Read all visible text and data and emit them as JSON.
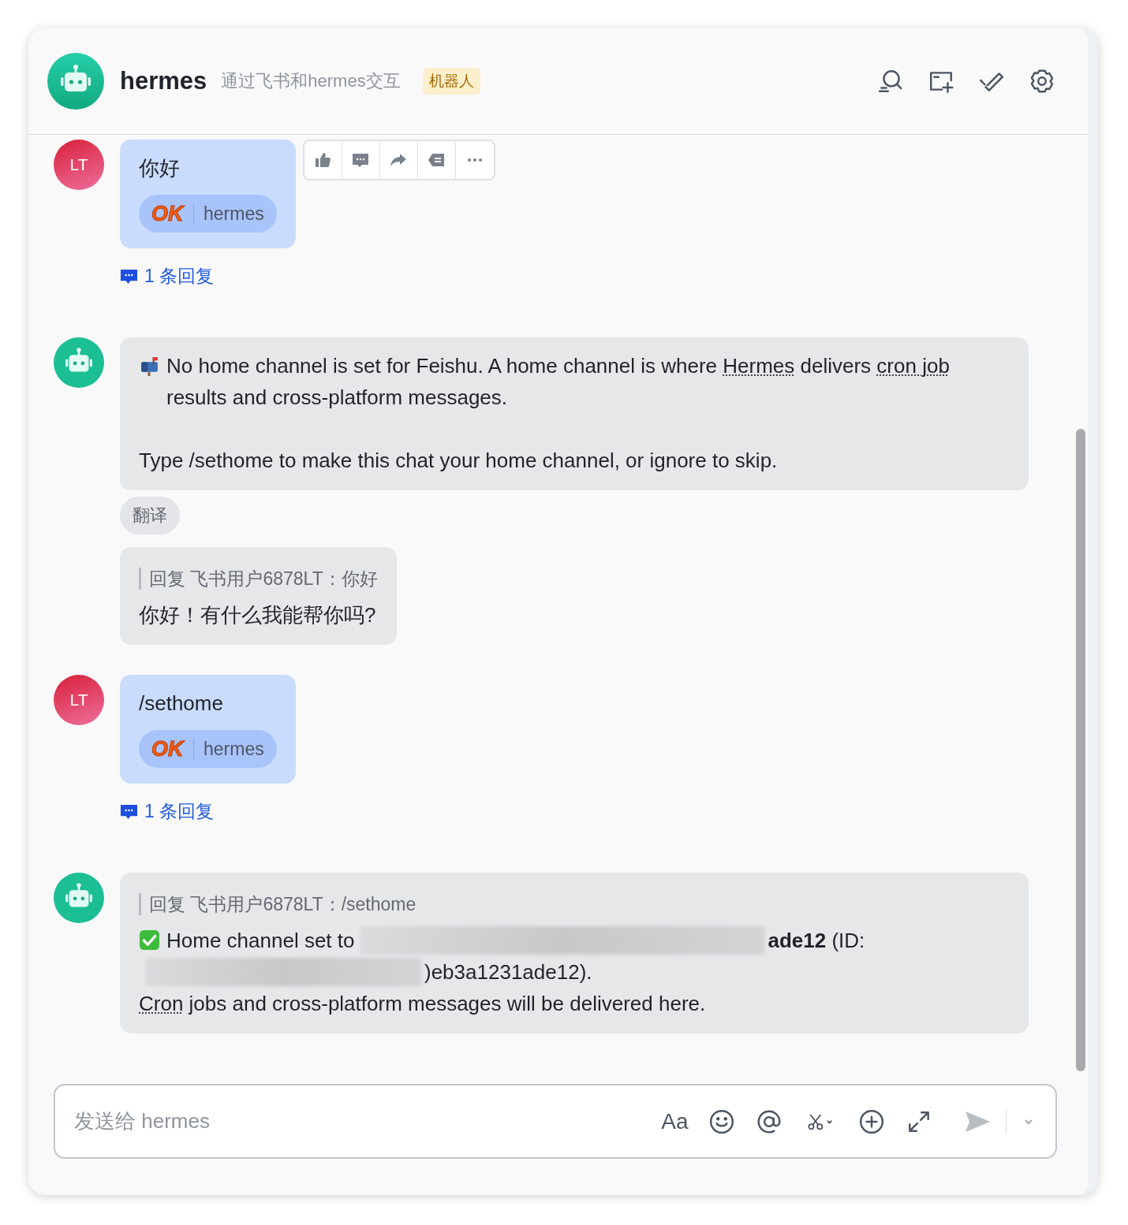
{
  "header": {
    "name": "hermes",
    "description": "通过飞书和hermes交互",
    "badge": "机器人"
  },
  "messages": [
    {
      "kind": "user",
      "show_avatar": true,
      "avatar": "LT",
      "hover_toolbar": true,
      "paragraphs": [
        {
          "runs": [
            {
              "kind": "text",
              "parts": [
                {
                  "text": "你好",
                  "dotted": false
                }
              ]
            }
          ]
        }
      ],
      "reaction": {
        "emoji": "OK",
        "user": "hermes"
      },
      "replies": "1 条回复"
    },
    {
      "kind": "bot",
      "show_avatar": true,
      "hover_toolbar": false,
      "paragraphs": [
        {
          "runs": [
            {
              "kind": "mailbox"
            },
            {
              "kind": "text",
              "parts": [
                {
                  "text": "No home channel is set for Feishu. A home channel is where ",
                  "dotted": false
                },
                {
                  "text": "Hermes",
                  "dotted": true
                },
                {
                  "text": " delivers ",
                  "dotted": false
                },
                {
                  "text": "cron job",
                  "dotted": true
                },
                {
                  "text": " results and cross-platform messages.",
                  "dotted": false
                }
              ]
            }
          ]
        },
        {
          "runs": [
            {
              "kind": "text",
              "parts": [
                {
                  "text": "Type /sethome to make this chat your home channel, or ignore to skip.",
                  "dotted": false
                }
              ]
            }
          ]
        }
      ],
      "translate": "翻译"
    },
    {
      "kind": "bot",
      "show_avatar": false,
      "hover_toolbar": false,
      "quote": "回复 飞书用户6878LT：你好",
      "paragraphs": [
        {
          "runs": [
            {
              "kind": "text",
              "parts": [
                {
                  "text": "你好！有什么我能帮你吗?",
                  "dotted": false
                }
              ]
            }
          ]
        }
      ]
    },
    {
      "kind": "user",
      "show_avatar": true,
      "avatar": "LT",
      "hover_toolbar": false,
      "paragraphs": [
        {
          "runs": [
            {
              "kind": "text",
              "parts": [
                {
                  "text": "/sethome",
                  "dotted": false
                }
              ]
            }
          ]
        }
      ],
      "reaction": {
        "emoji": "OK",
        "user": "hermes"
      },
      "replies": "1 条回复"
    },
    {
      "kind": "bot",
      "show_avatar": true,
      "hover_toolbar": false,
      "quote": "回复 飞书用户6878LT：/sethome",
      "paragraphs": [
        {
          "runs": [
            {
              "kind": "check"
            },
            {
              "kind": "text",
              "parts": [
                {
                  "text": "Home channel set to",
                  "dotted": false
                }
              ]
            },
            {
              "kind": "redacted"
            },
            {
              "kind": "text",
              "parts": [
                {
                  "text": "**ade12** (ID:",
                  "dotted": false
                }
              ]
            },
            {
              "kind": "redacted"
            },
            {
              "kind": "text",
              "parts": [
                {
                  "text": ")eb3a1231ade12).",
                  "dotted": false
                }
              ]
            },
            {
              "kind": "break"
            },
            {
              "kind": "text",
              "parts": [
                {
                  "text": "Cron",
                  "dotted": true
                },
                {
                  "text": " jobs and cross-platform messages will be delivered here.",
                  "dotted": false
                }
              ]
            }
          ]
        }
      ]
    }
  ],
  "composer": {
    "placeholder": "发送给 hermes",
    "format": "Aa"
  }
}
